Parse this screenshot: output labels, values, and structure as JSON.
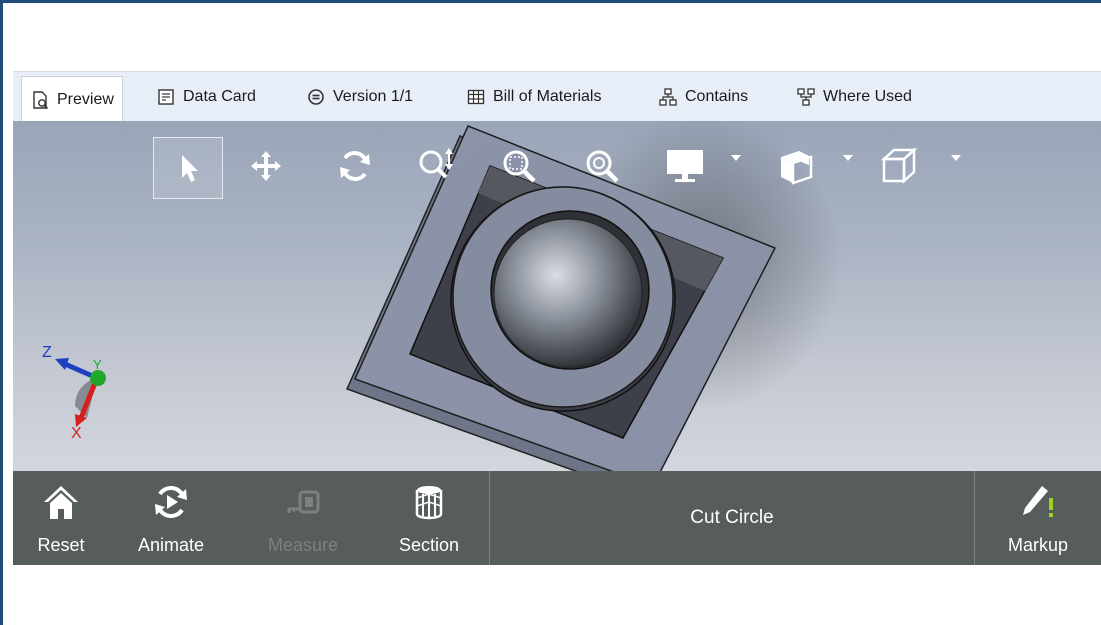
{
  "tabs": [
    {
      "label": "Preview",
      "icon": "preview-icon",
      "active": true
    },
    {
      "label": "Data Card",
      "icon": "data-card-icon",
      "active": false
    },
    {
      "label": "Version 1/1",
      "icon": "version-icon",
      "active": false
    },
    {
      "label": "Bill of Materials",
      "icon": "bill-of-materials-icon",
      "active": false
    },
    {
      "label": "Contains",
      "icon": "contains-icon",
      "active": false
    },
    {
      "label": "Where Used",
      "icon": "where-used-icon",
      "active": false
    }
  ],
  "viewer_toolbar": [
    {
      "icon": "select-arrow-icon",
      "selected": true
    },
    {
      "icon": "pan-icon"
    },
    {
      "icon": "rotate-icon"
    },
    {
      "icon": "zoom-icon"
    },
    {
      "icon": "zoom-to-area-icon"
    },
    {
      "icon": "zoom-to-fit-icon"
    },
    {
      "icon": "display-style-icon",
      "dropdown": true
    },
    {
      "icon": "view-orientation-icon",
      "dropdown": true
    },
    {
      "icon": "standard-views-icon",
      "dropdown": true
    }
  ],
  "triad": {
    "x": "X",
    "y": "Y",
    "z": "Z"
  },
  "bottom_bar": {
    "reset": "Reset",
    "animate": "Animate",
    "measure": "Measure",
    "section": "Section",
    "configuration": "Cut Circle",
    "markup": "Markup"
  },
  "colors": {
    "tab_bar_bg": "#e8eef7",
    "bottom_bar_bg": "#575c5c",
    "markup_accent": "#9bd21f",
    "frame": "#1f4e79"
  }
}
